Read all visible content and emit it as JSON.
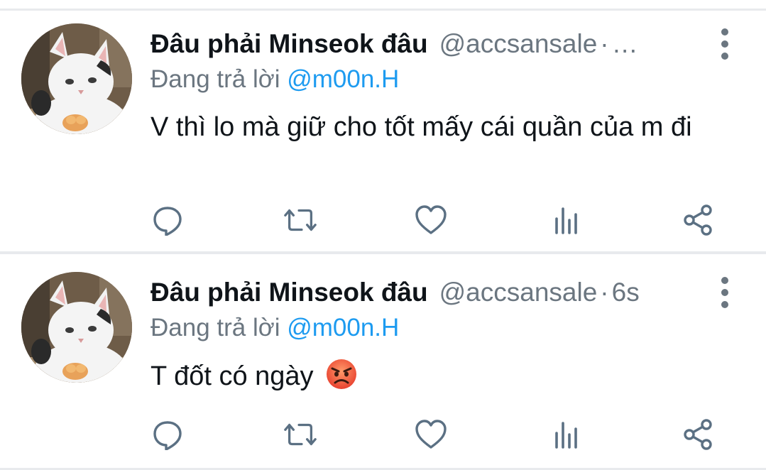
{
  "tweets": [
    {
      "name": "Đâu phải Minseok đâu",
      "handle": "@accsansale",
      "separator": "·",
      "time": "…",
      "reply_prefix": "Đang trả lời",
      "reply_to": "@m00n.H",
      "text": "V thì lo mà giữ cho tốt mấy cái quần của m đi",
      "emoji": ""
    },
    {
      "name": "Đâu phải Minseok đâu",
      "handle": "@accsansale",
      "separator": "·",
      "time": "6s",
      "reply_prefix": "Đang trả lời",
      "reply_to": "@m00n.H",
      "text": "T đốt có ngày",
      "emoji": "angry-face"
    }
  ],
  "icons": {
    "reply": "reply-icon",
    "retweet": "retweet-icon",
    "like": "heart-icon",
    "analytics": "analytics-icon",
    "share": "share-icon",
    "more": "more-vertical-icon",
    "avatar": "cat-avatar"
  },
  "colors": {
    "text": "#0f1419",
    "secondary": "#6b7680",
    "mention": "#1d9bf0",
    "divider": "#e8eaed",
    "icon": "#5b7083"
  }
}
